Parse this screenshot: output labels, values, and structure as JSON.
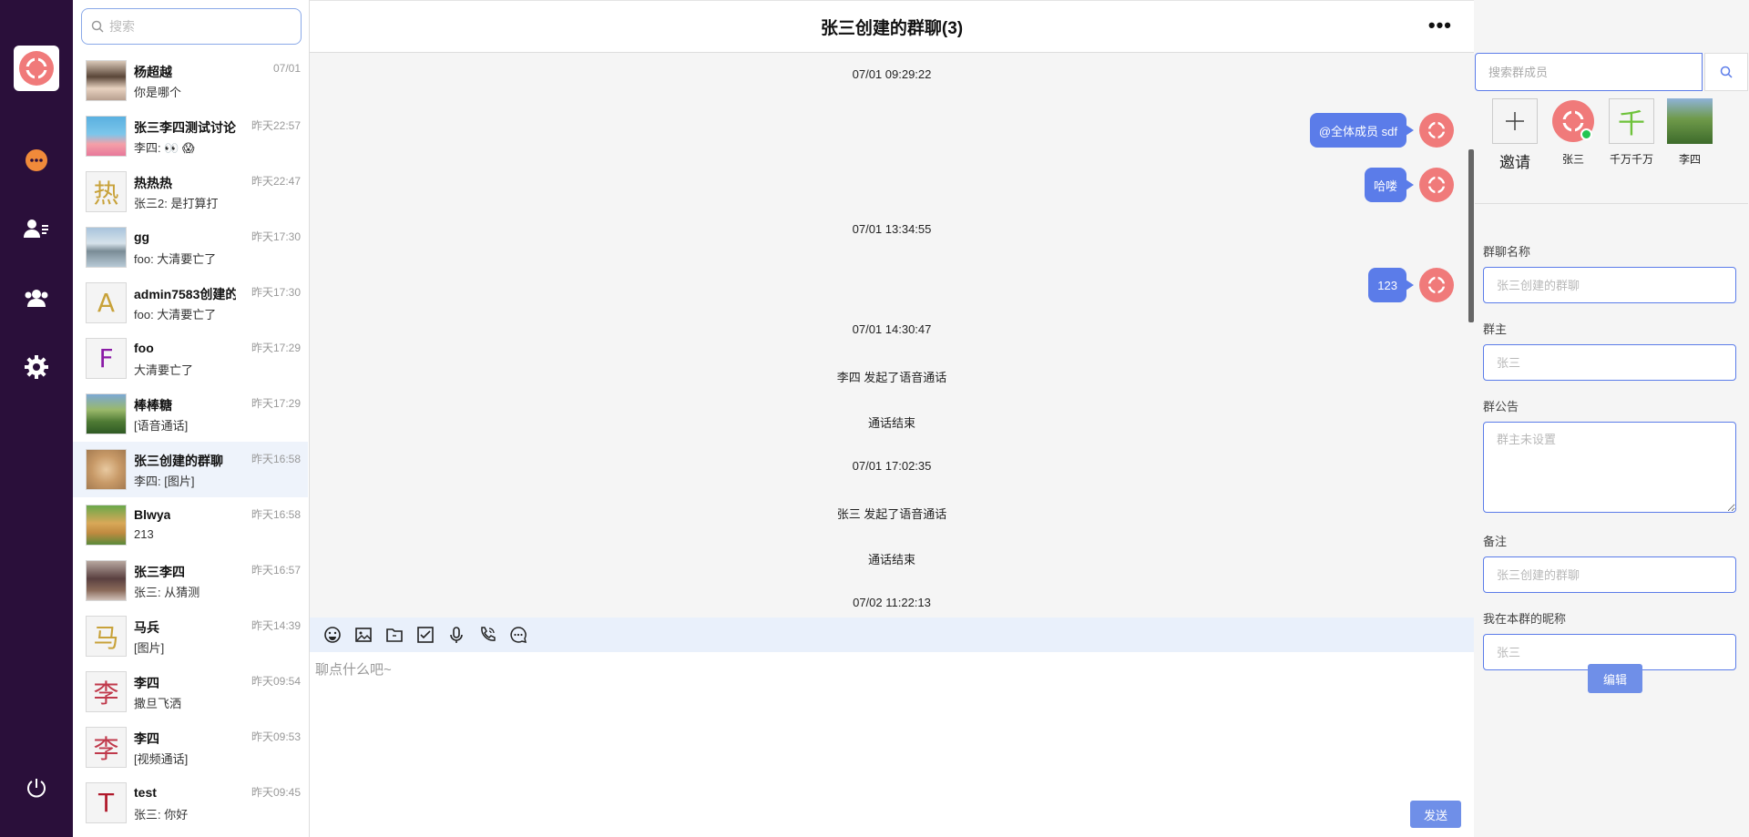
{
  "nav": {
    "items": [
      "chat",
      "contacts",
      "groups",
      "settings"
    ]
  },
  "search": {
    "placeholder": "搜索"
  },
  "conversations": [
    {
      "name": "杨超越",
      "time": "07/01",
      "last": "你是哪个",
      "avatar": "photo-girl"
    },
    {
      "name": "张三李四测试讨论",
      "time": "昨天22:57",
      "last": "李四: 👀 😱",
      "avatar": "photo-patrick"
    },
    {
      "name": "热热热",
      "time": "昨天22:47",
      "last": "张三2: 是打算打",
      "avatar_text": "热",
      "avatar_color": "#c8a23a"
    },
    {
      "name": "gg",
      "time": "昨天17:30",
      "last": "foo: 大清要亡了",
      "avatar": "photo-lake"
    },
    {
      "name": "admin7583创建的",
      "time": "昨天17:30",
      "last": "foo: 大清要亡了",
      "avatar_text": "A",
      "avatar_color": "#c8a23a"
    },
    {
      "name": "foo",
      "time": "昨天17:29",
      "last": "大清要亡了",
      "avatar_text": "F",
      "avatar_color": "#8a1aa6"
    },
    {
      "name": "棒棒糖",
      "time": "昨天17:29",
      "last": "[语音通话]",
      "avatar": "photo-mountain"
    },
    {
      "name": "张三创建的群聊",
      "time": "昨天16:58",
      "last": "李四: [图片]",
      "avatar": "photo-dog"
    },
    {
      "name": "Blwya",
      "time": "昨天16:58",
      "last": "213",
      "avatar": "photo-golden"
    },
    {
      "name": "张三李四",
      "time": "昨天16:57",
      "last": "张三: 从猜测",
      "avatar": "photo-person"
    },
    {
      "name": "马兵",
      "time": "昨天14:39",
      "last": "[图片]",
      "avatar_text": "马",
      "avatar_color": "#c8a23a"
    },
    {
      "name": "李四",
      "time": "昨天09:54",
      "last": "撒旦飞洒",
      "avatar_text": "李",
      "avatar_color": "#c0394b"
    },
    {
      "name": "李四",
      "time": "昨天09:53",
      "last": "[视频通话]",
      "avatar_text": "李",
      "avatar_color": "#c0394b"
    },
    {
      "name": "test",
      "time": "昨天09:45",
      "last": "张三: 你好",
      "avatar_text": "T",
      "avatar_color": "#b0182a"
    }
  ],
  "chat": {
    "title": "张三创建的群聊(3)",
    "more": "•••",
    "messages": {
      "t1": "07/01 09:29:22",
      "b1": "@全体成员 sdf",
      "b2": "哈喽",
      "t2": "07/01 13:34:55",
      "b3": "123",
      "t3": "07/01 14:30:47",
      "s1": "李四 发起了语音通话",
      "s2": "通话结束",
      "t4": "07/01 17:02:35",
      "s3": "张三 发起了语音通话",
      "s4": "通话结束",
      "t5": "07/02 11:22:13"
    },
    "composer_placeholder": "聊点什么吧~",
    "send_label": "发送"
  },
  "side": {
    "member_search_placeholder": "搜索群成员",
    "invite_label": "邀请",
    "members": [
      "张三",
      "千万千万",
      "李四"
    ],
    "member_text_avatar": "千",
    "form": {
      "name_label": "群聊名称",
      "name_placeholder": "张三创建的群聊",
      "owner_label": "群主",
      "owner_placeholder": "张三",
      "notice_label": "群公告",
      "notice_placeholder": "群主未设置",
      "remark_label": "备注",
      "remark_placeholder": "张三创建的群聊",
      "nick_label": "我在本群的昵称",
      "nick_placeholder": "张三",
      "edit_label": "编辑"
    }
  },
  "colors": {
    "rail": "#2a0f3a",
    "accent": "#5b7ce9",
    "logo": "#f07a7a",
    "online": "#23c552"
  }
}
